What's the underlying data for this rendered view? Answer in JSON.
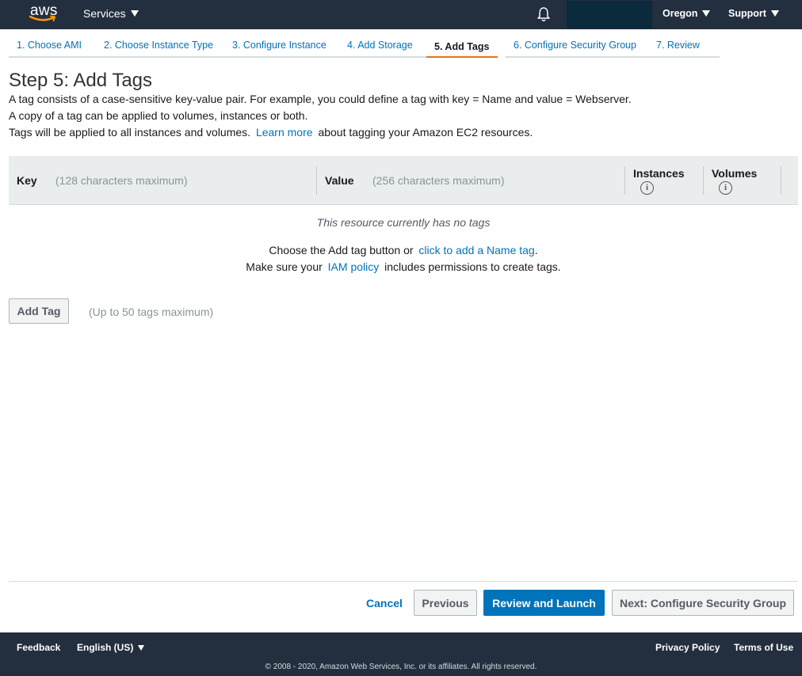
{
  "colors": {
    "nav_bg": "#232f3e",
    "accent_orange": "#ec7211",
    "link_blue": "#0073bb",
    "primary_button": "#0073bb"
  },
  "topnav": {
    "logo_text": "aws",
    "services_label": "Services",
    "region_label": "Oregon",
    "support_label": "Support",
    "bell_icon": "bell-icon"
  },
  "tabs": [
    {
      "label": "1. Choose AMI"
    },
    {
      "label": "2. Choose Instance Type"
    },
    {
      "label": "3. Configure Instance"
    },
    {
      "label": "4. Add Storage"
    },
    {
      "label": "5. Add Tags",
      "active": true
    },
    {
      "label": "6. Configure Security Group"
    },
    {
      "label": "7. Review"
    }
  ],
  "page": {
    "title": "Step 5: Add Tags",
    "desc_line1": "A tag consists of a case-sensitive key-value pair. For example, you could define a tag with key = Name and value = Webserver.",
    "desc_line2": "A copy of a tag can be applied to volumes, instances or both.",
    "desc_line3_before": "Tags will be applied to all instances and volumes.",
    "desc_line3_link": "Learn more",
    "desc_line3_after": "about tagging your Amazon EC2 resources."
  },
  "table": {
    "col_key": "Key",
    "col_key_hint": "(128 characters maximum)",
    "col_value": "Value",
    "col_value_hint": "(256 characters maximum)",
    "col_instances": "Instances",
    "col_volumes": "Volumes",
    "info_glyph": "i",
    "empty_message": "This resource currently has no tags",
    "instruction_before": "Choose the Add tag button or",
    "instruction_link": "click to add a Name tag",
    "instruction_after": ".",
    "iam_before": "Make sure your",
    "iam_link": "IAM policy",
    "iam_after": "includes permissions to create tags."
  },
  "actions": {
    "add_tag_label": "Add Tag",
    "add_tag_hint": "(Up to 50 tags maximum)",
    "cancel_label": "Cancel",
    "previous_label": "Previous",
    "review_launch_label": "Review and Launch",
    "next_label": "Next: Configure Security Group"
  },
  "footer": {
    "feedback_label": "Feedback",
    "language_label": "English (US)",
    "privacy_label": "Privacy Policy",
    "terms_label": "Terms of Use",
    "copyright": "© 2008 - 2020, Amazon Web Services, Inc. or its affiliates. All rights reserved."
  }
}
